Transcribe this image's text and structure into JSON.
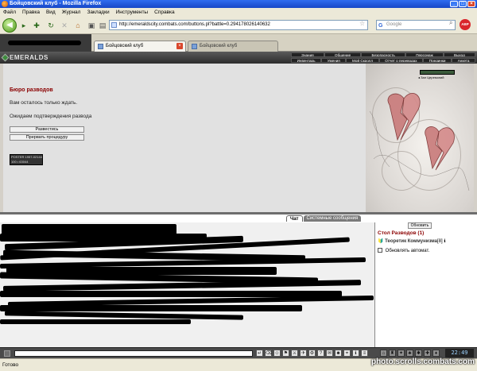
{
  "window": {
    "title": "Бойцовский клуб - Mozilla Firefox"
  },
  "menu": [
    "Файл",
    "Правка",
    "Вид",
    "Журнал",
    "Закладки",
    "Инструменты",
    "Справка"
  ],
  "nav": {
    "url": "http://emeraldscity.combats.com/buttons.pl?battle=0.294178026140632",
    "search_placeholder": "Google",
    "adblock_label": "ABP"
  },
  "tabs": [
    {
      "label": "Бойцовский клуб",
      "active": true
    },
    {
      "label": "Бойцовский клуб",
      "active": false
    }
  ],
  "game": {
    "logo": "EMERALDS",
    "menu_row1": [
      "Знания",
      "Общение",
      "Безопасность",
      "Персонаж",
      "Выход"
    ],
    "menu_row2": [
      "Инвентарь",
      "Умения",
      "Мой Скролл",
      "Отчет о переводах",
      "Поединки",
      "Анкета"
    ],
    "page_title": "Бюро разводов",
    "message_1": "Вам осталось только ждать.",
    "message_2": "Ожидаем подтверждения развода",
    "buttons": {
      "divorce": "Развестись",
      "cancel": "Прервать процедуру"
    },
    "hall_label": "Зал Церемоний",
    "counter": {
      "row1": "POSTER 1957-02144",
      "row2": "100 • 63044"
    }
  },
  "chat": {
    "tab_chat": "Чат",
    "tab_system": "Системные сообщения",
    "refresh_button": "Обновить",
    "room_title": "Стол Разводов (1)",
    "player_name": "Теоретик Коммунизма",
    "player_level": "[8]",
    "auto_refresh": "Обновлять автомат."
  },
  "clock": "22:49",
  "status": {
    "text": "Готово"
  },
  "watermark": "photo.scrolls.combats.com"
}
